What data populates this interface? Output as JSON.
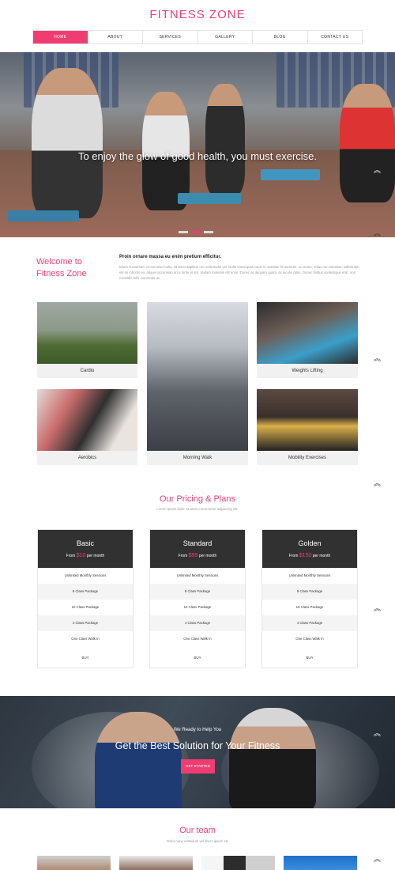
{
  "brand": "FITNESS ZONE",
  "nav": [
    "HOME",
    "ABOUT",
    "SERVICES",
    "GALLERY",
    "BLOG",
    "CONTACT US"
  ],
  "hero": {
    "caption": "To enjoy the glow of good health, you must exercise.",
    "slide_count": 3,
    "active_slide": 2
  },
  "welcome": {
    "title_line1": "Welcome to",
    "title_line2": "Fitness Zone",
    "heading": "Proin ornare massa eu enim pretium efficitur.",
    "text": "Etiam fermentum consectetur nullu, sit amet dapibus orci sollicitudin vel. Nulla consequat turpis in molestie fermentum. In ornare, tellus non interdum sollicitudin, elit mi lobortis ex, aliquet accumsan arcu tortor in leo. Nullam molestie elit enim. Donec ac aliquam quam, ac iaculis diam. Donec finibus scelerisque erat, non convallis felis commodo ac."
  },
  "gallery": [
    "Cardio",
    "Morning Walk",
    "Weights Lifting",
    "Aerobics",
    "Mobility Exercises"
  ],
  "pricing": {
    "title": "Our Pricing & Plans",
    "subtitle": "Lorem ipsum dolor sit amet consectetur adipiscing elit.",
    "from_text": "From",
    "per_text": "per month",
    "features": [
      "Unlimited Monthly Sessions",
      "8 Class Package",
      "10 Class Package",
      "4 Class Package",
      "One Class Walk In"
    ],
    "plans": [
      {
        "name": "Basic",
        "price": "$10",
        "buy": "BUY"
      },
      {
        "name": "Standard",
        "price": "$99",
        "buy": "BUY"
      },
      {
        "name": "Golden",
        "price": "$150",
        "buy": "BUY"
      }
    ]
  },
  "banner": {
    "kicker": "We Ready to Help You",
    "title": "Get the Best Solution for Your Fitness",
    "button": "GET STARTED"
  },
  "team": {
    "title": "Our team",
    "subtitle": "Dolor nunc estibulum vel libero ipsum sit."
  },
  "colors": {
    "accent": "#ef3d72",
    "dark": "#313131"
  }
}
